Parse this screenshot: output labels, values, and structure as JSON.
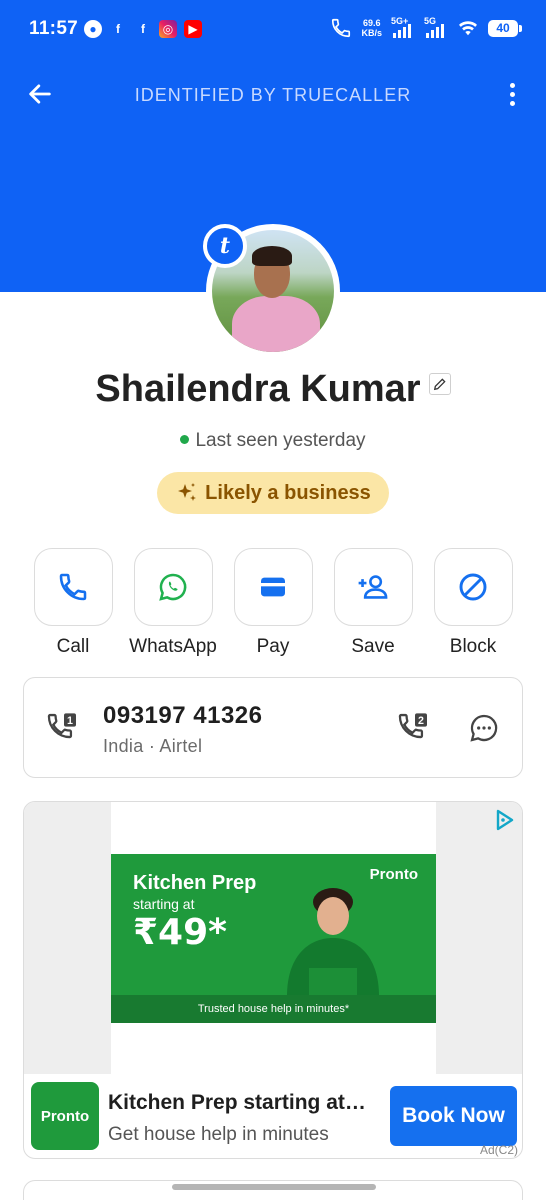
{
  "status_bar": {
    "time": "11:57",
    "speed_value": "69.6",
    "speed_unit": "KB/s",
    "net1": "5G+",
    "net2": "5G",
    "battery": "40"
  },
  "header": {
    "title": "IDENTIFIED BY TRUECALLER"
  },
  "profile": {
    "badge_letter": "t",
    "name": "Shailendra Kumar",
    "last_seen": "Last seen yesterday",
    "business_chip": "Likely a business"
  },
  "actions": [
    {
      "label": "Call",
      "icon": "phone-icon"
    },
    {
      "label": "WhatsApp",
      "icon": "whatsapp-icon"
    },
    {
      "label": "Pay",
      "icon": "wallet-icon"
    },
    {
      "label": "Save",
      "icon": "add-contact-icon"
    },
    {
      "label": "Block",
      "icon": "block-icon"
    }
  ],
  "number_card": {
    "sim_badge": "1",
    "number": "093197 41326",
    "subtitle": "India · Airtel",
    "sim2_badge": "2"
  },
  "ad": {
    "banner_title": "Kitchen Prep",
    "banner_sub": "starting at",
    "banner_price": "₹49*",
    "banner_brand": "Pronto",
    "banner_footer": "Trusted house help in minutes*",
    "logo_text": "Pronto",
    "title": "Kitchen Prep starting at…",
    "description": "Get house help in minutes",
    "cta": "Book Now",
    "tag": "Ad(C2)"
  },
  "colors": {
    "brand_blue": "#0f62f5",
    "accent_blue": "#1570ef",
    "chip_bg": "#fbe6a6",
    "ad_green": "#1f9a3c"
  }
}
